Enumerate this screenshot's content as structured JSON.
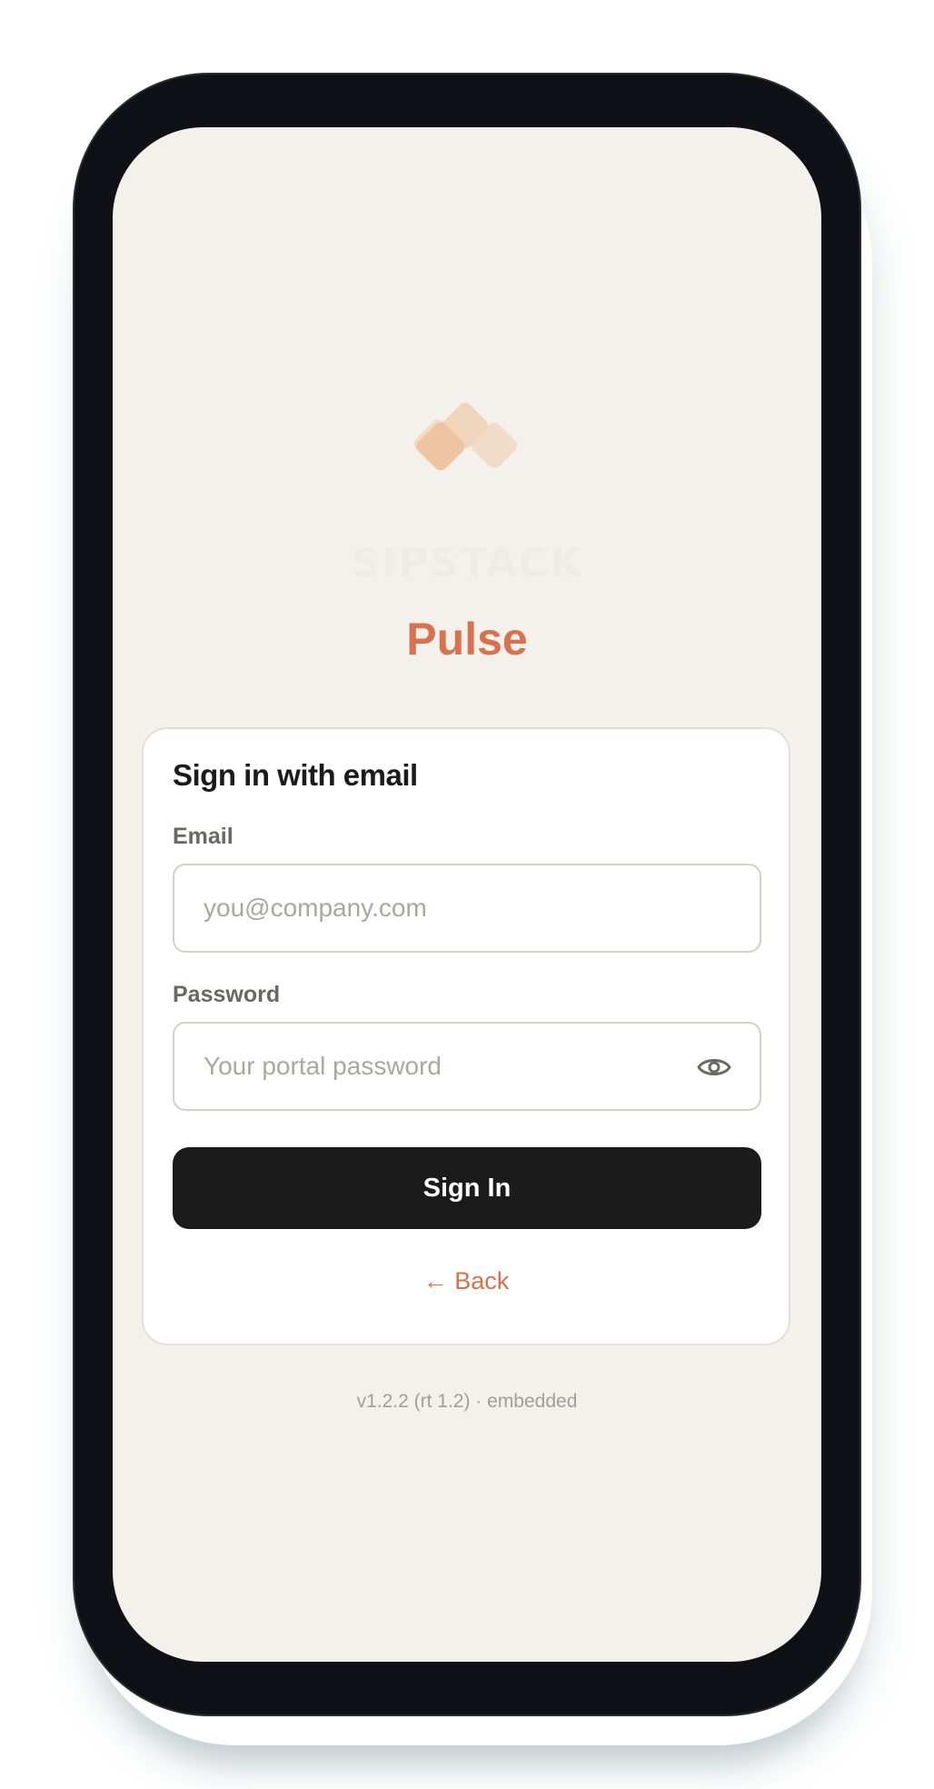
{
  "brand": {
    "faint_wordmark": "SIPSTACK",
    "product_name": "Pulse",
    "logo_icon": "stacked-diamonds-logo",
    "accent_color": "#d7714f"
  },
  "login_card": {
    "title": "Sign in with email",
    "email": {
      "label": "Email",
      "value": "",
      "placeholder": "you@company.com"
    },
    "password": {
      "label": "Password",
      "value": "",
      "placeholder": "Your portal password",
      "toggle_icon": "eye-icon"
    },
    "submit_label": "Sign In",
    "back_label": "← Back"
  },
  "footer": {
    "version_text": "v1.2.2 (rt 1.2) · embedded"
  }
}
